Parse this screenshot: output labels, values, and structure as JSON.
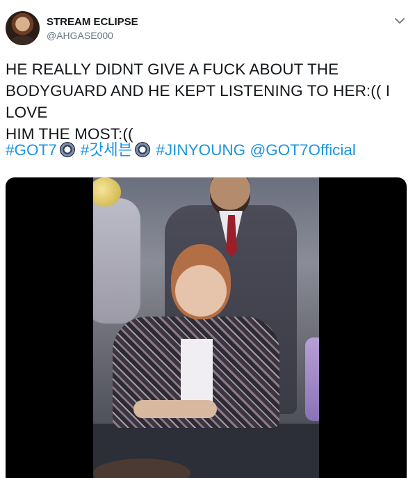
{
  "tweet": {
    "display_name": "STREAM ECLIPSE",
    "handle": "@AHGASE000",
    "text_lines": [
      "HE REALLY DIDNT GIVE A FUCK ABOUT THE",
      "BODYGUARD AND HE KEPT LISTENING TO HER:(( I LOVE",
      "HIM THE MOST:(("
    ],
    "hashtags": [
      "#GOT7",
      "#갓세븐",
      "#JINYOUNG"
    ],
    "mention": "@GOT7Official",
    "hashtag_emoji_icon": "got7-hashflag-icon"
  },
  "icons": {
    "menu": "chevron-down-icon",
    "avatar": "profile-avatar"
  },
  "colors": {
    "text": "#14171a",
    "secondary": "#657786",
    "link": "#1b95e0",
    "media_background": "#000000"
  }
}
